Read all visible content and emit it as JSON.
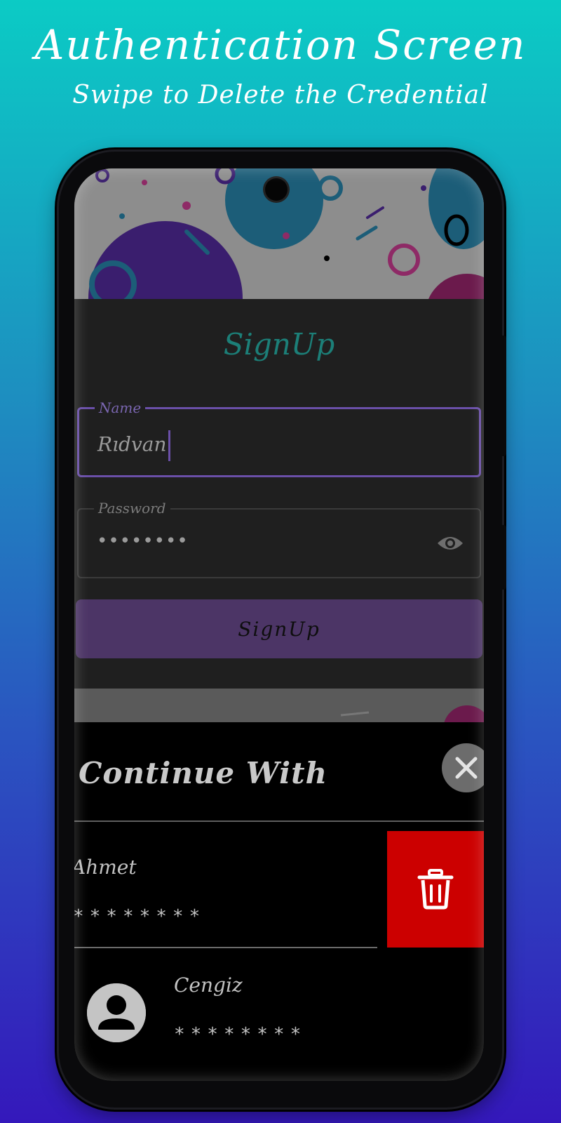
{
  "promo": {
    "title": "Authentication Screen",
    "subtitle": "Swipe to Delete the Credential"
  },
  "signup": {
    "title": "SignUp",
    "name_label": "Name",
    "name_value": "Rıdvan",
    "password_label": "Password",
    "password_value": "••••••••",
    "button_label": "SignUp"
  },
  "continue_sheet": {
    "title": "Continue With",
    "credentials": [
      {
        "name": "Ahmet",
        "password": "********"
      },
      {
        "name": "Cengiz",
        "password": "********"
      }
    ]
  },
  "colors": {
    "accent_purple": "#6a4fa8",
    "title_teal": "#1c7f78",
    "delete_red": "#cc0000"
  },
  "icons": [
    "eye-icon",
    "close-icon",
    "trash-icon",
    "person-avatar-icon"
  ]
}
